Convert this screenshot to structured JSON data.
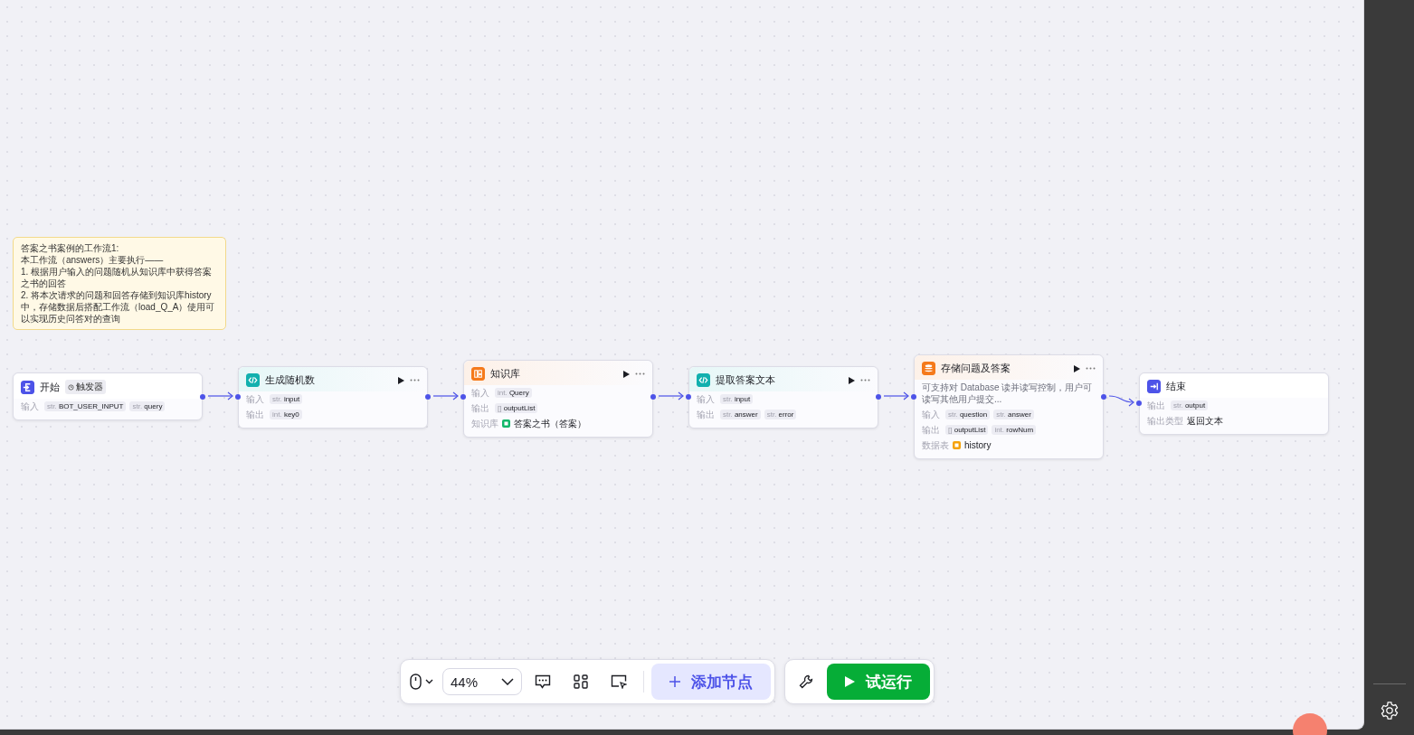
{
  "note": {
    "text": "答案之书案例的工作流1:\n本工作流（answers）主要执行——\n1. 根据用户输入的问题随机从知识库中获得答案之书的回答\n2. 将本次请求的问题和回答存储到知识库history中，存储数据后搭配工作流（load_Q_A）使用可以实现历史问答对的查询"
  },
  "nodes": [
    {
      "kind": "start",
      "title": "开始",
      "badge": "触发器",
      "runnable": false,
      "rows": [
        {
          "kind": "tags",
          "label": "输入",
          "tags": [
            {
              "type": "str.",
              "name": "BOT_USER_INPUT"
            },
            {
              "type": "str.",
              "name": "query"
            }
          ]
        }
      ]
    },
    {
      "kind": "code",
      "title": "生成随机数",
      "runnable": true,
      "rows": [
        {
          "kind": "tags",
          "label": "输入",
          "tags": [
            {
              "type": "str.",
              "name": "input"
            }
          ]
        },
        {
          "kind": "tags",
          "label": "输出",
          "tags": [
            {
              "type": "int.",
              "name": "key0"
            }
          ]
        }
      ]
    },
    {
      "kind": "knowledge",
      "title": "知识库",
      "runnable": true,
      "rows": [
        {
          "kind": "tags",
          "label": "输入",
          "tags": [
            {
              "type": "int.",
              "name": "Query"
            }
          ]
        },
        {
          "kind": "tags",
          "label": "输出",
          "tags": [
            {
              "type": "[]",
              "name": "outputList"
            }
          ]
        },
        {
          "kind": "resource",
          "label": "知识库",
          "value": "答案之书（答案）"
        }
      ]
    },
    {
      "kind": "code",
      "title": "提取答案文本",
      "runnable": true,
      "rows": [
        {
          "kind": "tags",
          "label": "输入",
          "tags": [
            {
              "type": "str.",
              "name": "input"
            }
          ]
        },
        {
          "kind": "tags",
          "label": "输出",
          "tags": [
            {
              "type": "str.",
              "name": "answer"
            },
            {
              "type": "str.",
              "name": "error"
            }
          ]
        }
      ]
    },
    {
      "kind": "database",
      "title": "存储问题及答案",
      "runnable": true,
      "rows": [
        {
          "kind": "desc",
          "value": "可支持对 Database 读并读写控制，用户可读写其他用户提交..."
        },
        {
          "kind": "tags",
          "label": "输入",
          "tags": [
            {
              "type": "str.",
              "name": "question"
            },
            {
              "type": "str.",
              "name": "answer"
            }
          ]
        },
        {
          "kind": "tags",
          "label": "输出",
          "tags": [
            {
              "type": "[]",
              "name": "outputList"
            },
            {
              "type": "int.",
              "name": "rowNum"
            }
          ]
        },
        {
          "kind": "resource",
          "label": "数据表",
          "value": "history"
        }
      ]
    },
    {
      "kind": "end",
      "title": "结束",
      "runnable": false,
      "rows": [
        {
          "kind": "tags",
          "label": "输出",
          "tags": [
            {
              "type": "str.",
              "name": "output"
            }
          ]
        },
        {
          "kind": "text",
          "label": "输出类型",
          "value": "返回文本"
        }
      ]
    }
  ],
  "toolbar": {
    "zoom": "44%",
    "add_node": "添加节点",
    "run": "试运行"
  }
}
